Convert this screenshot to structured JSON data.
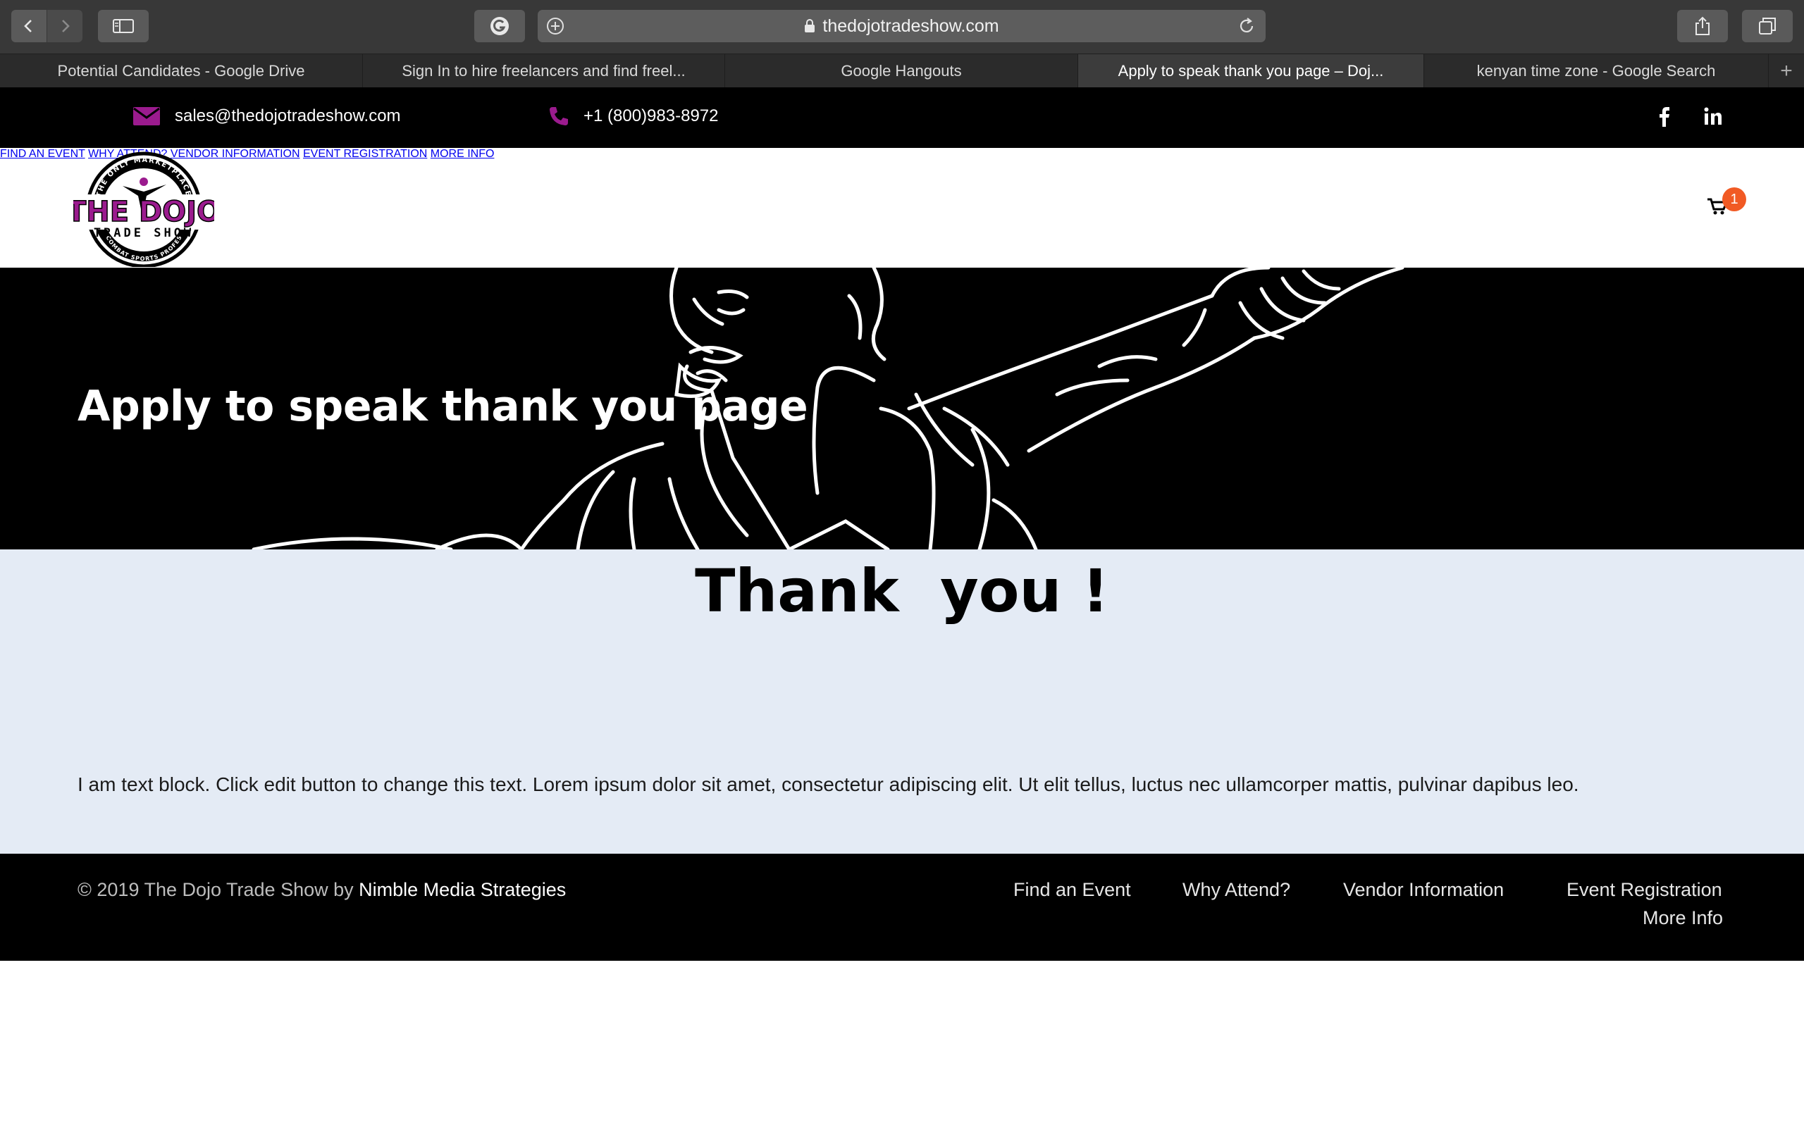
{
  "browser": {
    "url": "thedojotradeshow.com",
    "tabs": [
      {
        "label": "Potential Candidates - Google Drive",
        "active": false
      },
      {
        "label": "Sign In to hire freelancers and find freel...",
        "active": false
      },
      {
        "label": "Google Hangouts",
        "active": false
      },
      {
        "label": "Apply to speak thank you page – Doj...",
        "active": true
      },
      {
        "label": "kenyan time zone - Google Search",
        "active": false
      }
    ]
  },
  "topbar": {
    "email": "sales@thedojotradeshow.com",
    "phone": "+1 (800)983-8972",
    "icons": [
      "email-icon",
      "phone-icon",
      "facebook-icon",
      "linkedin-icon"
    ]
  },
  "logo": {
    "arc_text": "THE ONLY MARKETPLACE FOR",
    "main": "THE DOJO",
    "sub": "TRADE SHOW",
    "bottom_text": "COMBAT SPORTS PROFESSIONALS"
  },
  "nav": {
    "items": [
      "FIND AN EVENT",
      "WHY ATTEND?",
      "VENDOR INFORMATION",
      "EVENT REGISTRATION",
      "MORE INFO"
    ],
    "cart_count": "1"
  },
  "hero": {
    "title": "Apply to speak thank you page"
  },
  "content": {
    "heading": "Thank  you !",
    "text": "I am text block. Click edit button to change this text. Lorem ipsum dolor sit amet, consectetur adipiscing elit. Ut elit tellus, luctus nec ullamcorper mattis, pulvinar dapibus leo."
  },
  "footer": {
    "copyright_prefix": "© 2019 The Dojo Trade Show by ",
    "copyright_brand": "Nimble Media Strategies",
    "links": [
      "Find an Event",
      "Why Attend?",
      "Vendor Information",
      "Event Registration",
      "More Info"
    ]
  },
  "colors": {
    "accent_purple": "#9b1b8e",
    "badge_orange": "#f15a24",
    "content_bg": "#e4ebf5"
  }
}
